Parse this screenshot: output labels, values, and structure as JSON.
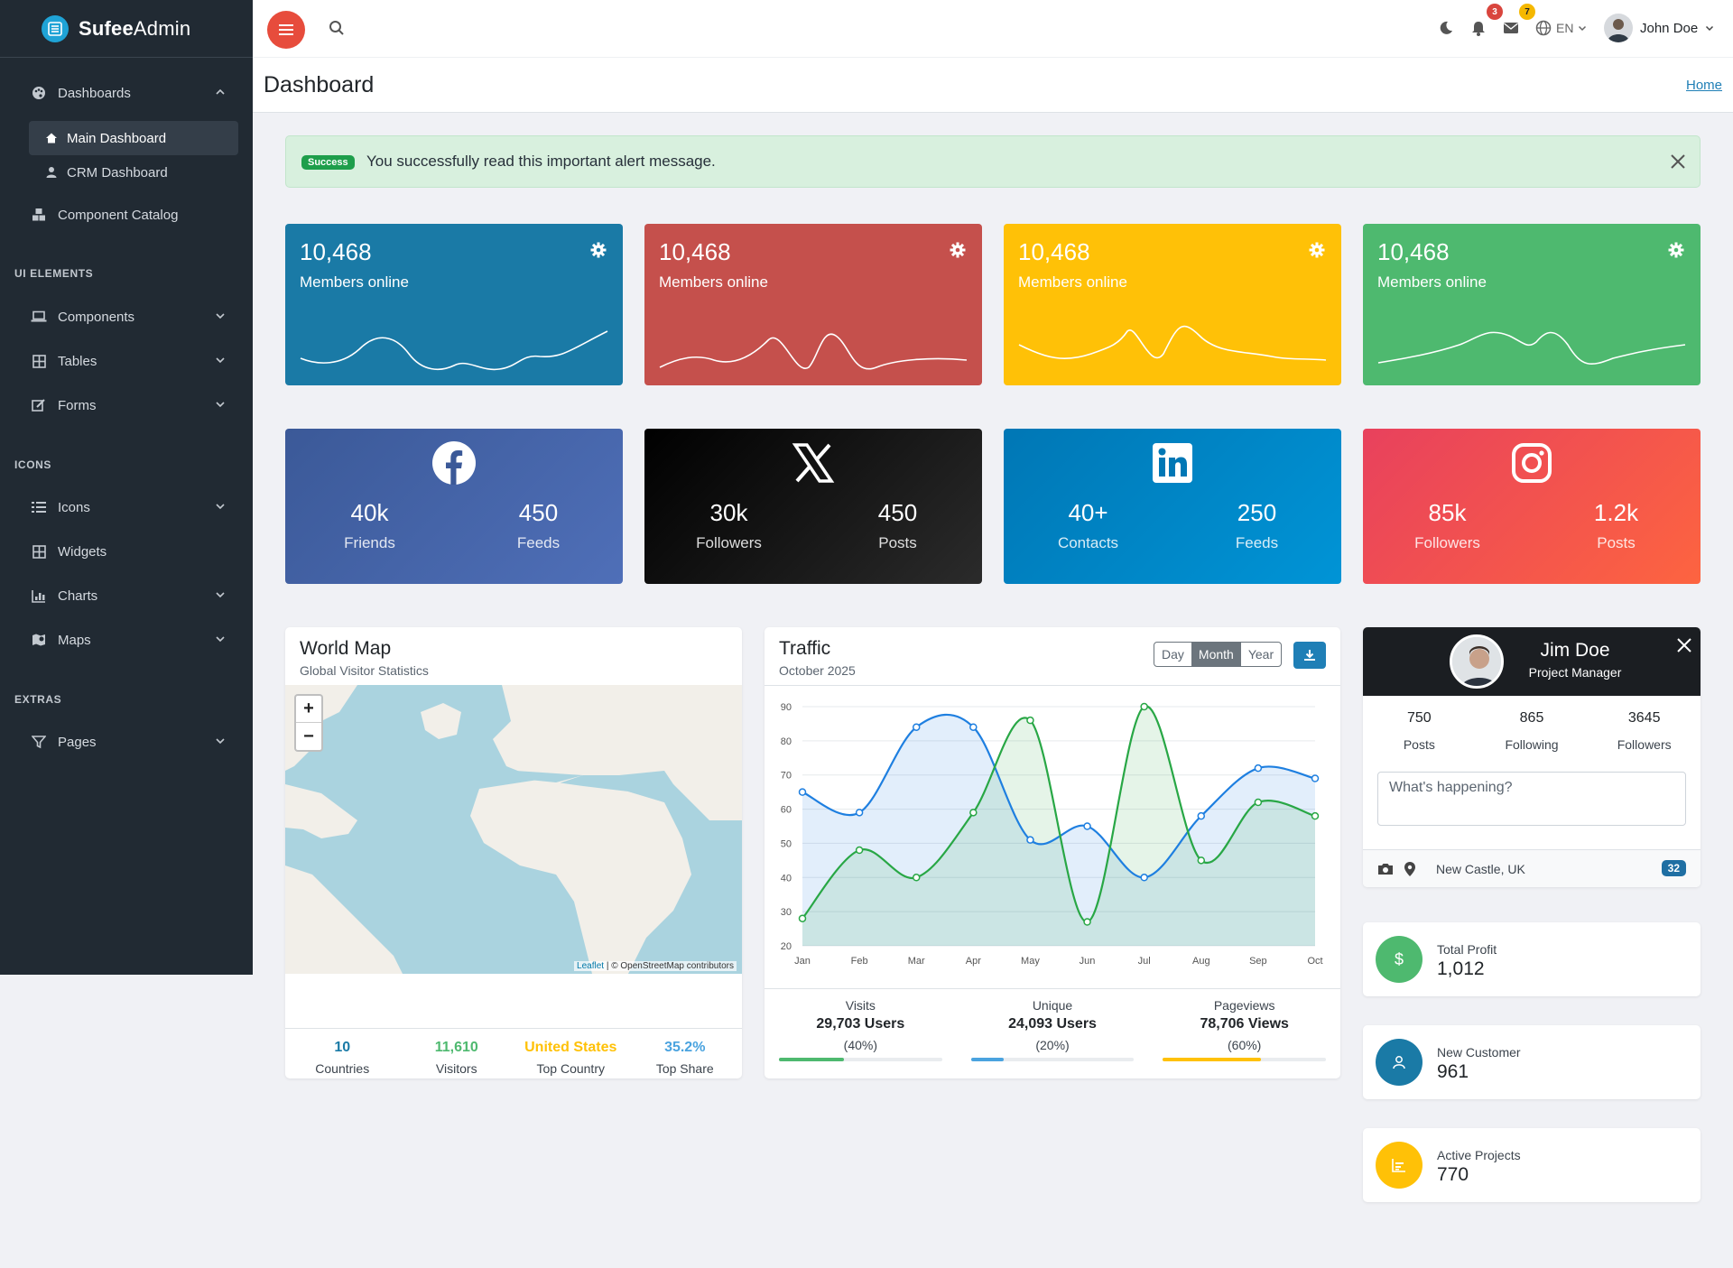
{
  "app": {
    "brand_bold": "Sufee",
    "brand_rest": "Admin"
  },
  "sidebar": {
    "dashboards": "Dashboards",
    "main_dashboard": "Main Dashboard",
    "crm_dashboard": "CRM Dashboard",
    "component_catalog": "Component Catalog",
    "head_ui": "UI ELEMENTS",
    "components": "Components",
    "tables": "Tables",
    "forms": "Forms",
    "head_icons": "ICONS",
    "icons": "Icons",
    "widgets": "Widgets",
    "charts": "Charts",
    "maps": "Maps",
    "head_extras": "EXTRAS",
    "pages": "Pages"
  },
  "topbar": {
    "notif_count": "3",
    "mail_count": "7",
    "lang": "EN",
    "user": "John Doe"
  },
  "page": {
    "title": "Dashboard",
    "breadcrumb": "Home"
  },
  "alert": {
    "label": "Success",
    "message": "You successfully read this important alert message."
  },
  "stat_cards": [
    {
      "value": "10,468",
      "label": "Members online",
      "color": "#1a7aa6"
    },
    {
      "value": "10,468",
      "label": "Members online",
      "color": "#c5504c"
    },
    {
      "value": "10,468",
      "label": "Members online",
      "color": "#ffc107"
    },
    {
      "value": "10,468",
      "label": "Members online",
      "color": "#4eb96f"
    }
  ],
  "social": [
    {
      "network": "facebook",
      "a_val": "40k",
      "a_lab": "Friends",
      "b_val": "450",
      "b_lab": "Feeds"
    },
    {
      "network": "x",
      "a_val": "30k",
      "a_lab": "Followers",
      "b_val": "450",
      "b_lab": "Posts"
    },
    {
      "network": "linkedin",
      "a_val": "40+",
      "a_lab": "Contacts",
      "b_val": "250",
      "b_lab": "Feeds"
    },
    {
      "network": "instagram",
      "a_val": "85k",
      "a_lab": "Followers",
      "b_val": "1.2k",
      "b_lab": "Posts"
    }
  ],
  "world_map": {
    "title": "World Map",
    "subtitle": "Global Visitor Statistics",
    "attribution_link": "Leaflet",
    "attribution_rest": "| © OpenStreetMap contributors",
    "stats": [
      {
        "value": "10",
        "label": "Countries",
        "color": "#1a7aa6"
      },
      {
        "value": "11,610",
        "label": "Visitors",
        "color": "#4eb96f"
      },
      {
        "value": "United States",
        "label": "Top Country",
        "color": "#ffc107"
      },
      {
        "value": "35.2%",
        "label": "Top Share",
        "color": "#4aa3df"
      }
    ]
  },
  "traffic": {
    "title": "Traffic",
    "subtitle": "October 2025",
    "ranges": [
      "Day",
      "Month",
      "Year"
    ],
    "active_range": "Month",
    "stats": [
      {
        "title": "Visits",
        "value": "29,703 Users",
        "pct": "(40%)",
        "fill": 0.4,
        "color": "#4eb96f"
      },
      {
        "title": "Unique",
        "value": "24,093 Users",
        "pct": "(20%)",
        "fill": 0.2,
        "color": "#4aa3df"
      },
      {
        "title": "Pageviews",
        "value": "78,706 Views",
        "pct": "(60%)",
        "fill": 0.6,
        "color": "#ffc107"
      }
    ]
  },
  "chart_data": {
    "type": "area",
    "x": [
      "Jan",
      "Feb",
      "Mar",
      "Apr",
      "May",
      "Jun",
      "Jul",
      "Aug",
      "Sep",
      "Oct"
    ],
    "ylim": [
      20,
      90
    ],
    "yticks": [
      20,
      30,
      40,
      50,
      60,
      70,
      80,
      90
    ],
    "series": [
      {
        "values": [
          65,
          59,
          84,
          84,
          51,
          55,
          40,
          58,
          72,
          69
        ],
        "color": "#1e7fe0"
      },
      {
        "values": [
          28,
          48,
          40,
          59,
          86,
          27,
          90,
          45,
          62,
          58
        ],
        "color": "#28a745"
      }
    ]
  },
  "profile": {
    "name": "Jim Doe",
    "role": "Project Manager",
    "stats": [
      {
        "v": "750",
        "l": "Posts"
      },
      {
        "v": "865",
        "l": "Following"
      },
      {
        "v": "3645",
        "l": "Followers"
      }
    ],
    "placeholder": "What's happening?",
    "location": "New Castle, UK",
    "count": "32"
  },
  "kpis": [
    {
      "title": "Total Profit",
      "value": "1,012",
      "color": "#4eb96f",
      "icon": "dollar-icon"
    },
    {
      "title": "New Customer",
      "value": "961",
      "color": "#1a7aa6",
      "icon": "user-icon"
    },
    {
      "title": "Active Projects",
      "value": "770",
      "color": "#ffc107",
      "icon": "bar-chart-icon"
    }
  ]
}
